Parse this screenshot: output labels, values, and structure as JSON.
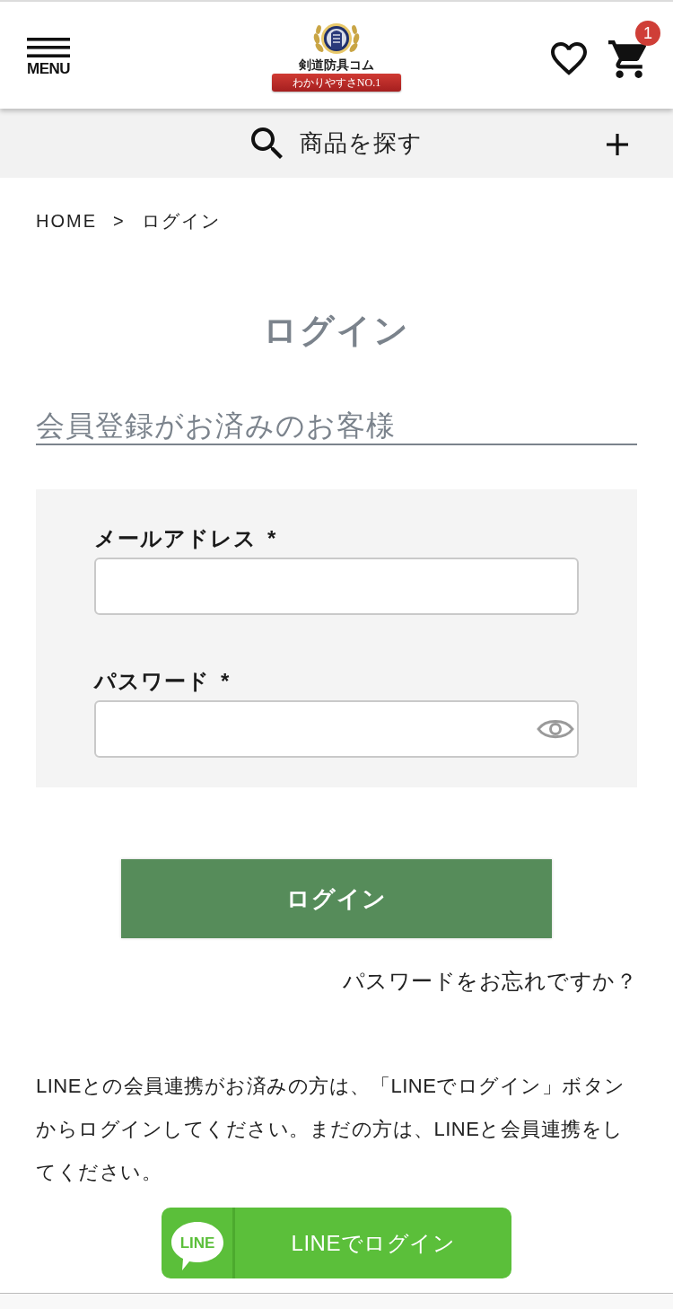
{
  "header": {
    "menu_label": "MENU",
    "logo": {
      "name": "剣道防具コム",
      "tagline": "わかりやすさNO.1"
    },
    "cart_count": "1"
  },
  "search_bar": {
    "label": "商品を探す"
  },
  "breadcrumb": {
    "items": [
      "HOME",
      "ログイン"
    ],
    "separator": ">"
  },
  "page_title": "ログイン",
  "section_title": "会員登録がお済みのお客様",
  "form": {
    "fields": [
      {
        "kind": "email",
        "label": "メールアドレス",
        "required_mark": "*"
      },
      {
        "kind": "password",
        "label": "パスワード",
        "required_mark": "*"
      }
    ]
  },
  "login_button": "ログイン",
  "forgot_link": "パスワードをお忘れですか？",
  "line_note": "LINEとの会員連携がお済みの方は、「LINEでログイン」ボタンからログインしてください。まだの方は、LINEと会員連携をしてください。",
  "line_button": {
    "logo_text": "LINE",
    "label": "LINEでログイン"
  }
}
